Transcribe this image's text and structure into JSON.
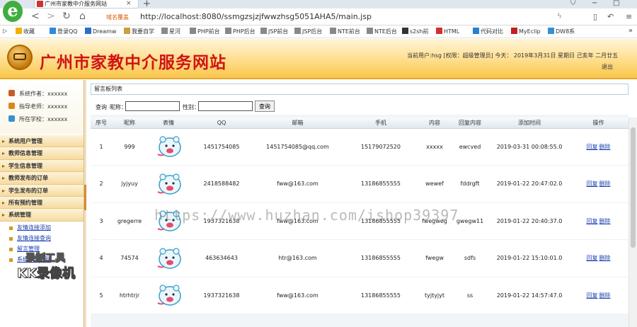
{
  "browser": {
    "tab_title": "广州市家教中介服务网站",
    "tab_close": "×",
    "new_tab": "+",
    "url_zone": "域名覆盖",
    "url": "http://localhost:8080/ssmgzsjzjfwwzhsg5051AHA5/main.jsp",
    "logo_letter": "e"
  },
  "bookmarks": [
    {
      "label": "收藏",
      "color": "#f3b000"
    },
    {
      "label": "登录QQ",
      "color": "#2a8ae0"
    },
    {
      "label": "Dreamw",
      "color": "#2a6fc7"
    },
    {
      "label": "我要自学",
      "color": "#c8a040"
    },
    {
      "label": "星河",
      "color": "#888888"
    },
    {
      "label": "PHP前台",
      "color": "#888888"
    },
    {
      "label": "PHP后台",
      "color": "#888888"
    },
    {
      "label": "JSP前台",
      "color": "#888888"
    },
    {
      "label": "JSP后台",
      "color": "#888888"
    },
    {
      "label": "NTE前台",
      "color": "#888888"
    },
    {
      "label": "NTE后台",
      "color": "#888888"
    },
    {
      "label": "s2sh前",
      "color": "#333333"
    },
    {
      "label": "HTML",
      "color": "#d23030"
    },
    {
      "label": "代码对比",
      "color": "#2a7fd0"
    },
    {
      "label": "MyEclip",
      "color": "#c02020"
    },
    {
      "label": "DW8系",
      "color": "#3a8fd0"
    }
  ],
  "header": {
    "title": "广州市家教中介服务网站",
    "info": "当前用户:hsg [权限：超级管理员]  今天：  2019年3月31日 星期日 己亥年 二月廿五",
    "logout": "退出"
  },
  "sidebar": {
    "user_lines": [
      {
        "label": "系统作者：xxxxxx",
        "color": "#c85a2a"
      },
      {
        "label": "指导老师：xxxxxx",
        "color": "#d88a1a"
      },
      {
        "label": "所在学校：xxxxxx",
        "color": "#3a8fd0"
      }
    ],
    "menu": [
      "系统用户管理",
      "教师信息管理",
      "学生信息管理",
      "教师发布的订单",
      "学生发布的订单",
      "所有预约管理",
      "系统管理"
    ],
    "submenu": [
      "友情连接添加",
      "友情连接查询",
      "留言管理",
      "系统公告管理"
    ]
  },
  "main": {
    "panel_title": "留言板列表",
    "search": {
      "label_query": "查询",
      "label_nickname": "昵称：",
      "label_gender": "性别：",
      "nickname_value": "",
      "gender_value": "",
      "button": "查询"
    },
    "columns": [
      "序号",
      "昵称",
      "表情",
      "QQ",
      "邮箱",
      "手机",
      "内容",
      "回复内容",
      "添加时间",
      "操作"
    ],
    "rows": [
      {
        "no": "1",
        "nick": "999",
        "qq": "1451754085",
        "email": "1451754085@qq.com",
        "phone": "15179072520",
        "content": "xxxxx",
        "reply": "ewcved",
        "time": "2019-03-31 00:08:55.0"
      },
      {
        "no": "2",
        "nick": "jyjyuy",
        "qq": "2418588482",
        "email": "fww@163.com",
        "phone": "13186855555",
        "content": "wewef",
        "reply": "fddrgft",
        "time": "2019-01-22 20:47:02.0"
      },
      {
        "no": "3",
        "nick": "gregerre",
        "qq": "1937321638",
        "email": "fww@163.com",
        "phone": "13186855555",
        "content": "fwegweg",
        "reply": "gwegw11",
        "time": "2019-01-22 20:40:37.0"
      },
      {
        "no": "4",
        "nick": "74574",
        "qq": "463634643",
        "email": "htr@163.com",
        "phone": "13186855555",
        "content": "fwegw",
        "reply": "sdfs",
        "time": "2019-01-22 15:10:01.0"
      },
      {
        "no": "5",
        "nick": "htrhtrjr",
        "qq": "1937321638",
        "email": "fww@163.com",
        "phone": "13186855555",
        "content": "tyjtyjyt",
        "reply": "ss",
        "time": "2019-01-22 14:57:47.0"
      }
    ],
    "op_reply": "回复",
    "op_delete": "删除"
  },
  "watermark": {
    "url": "https://www.huzhan.com/ishop39397",
    "kk_line1": "录制工具",
    "kk_line2": "KK录像机"
  }
}
